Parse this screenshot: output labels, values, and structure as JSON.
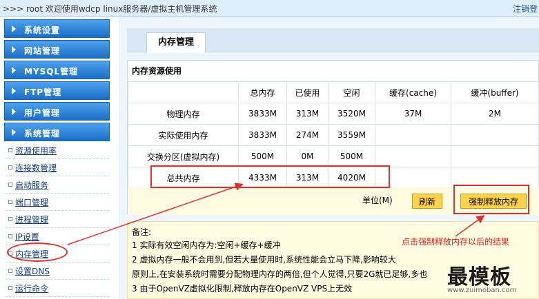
{
  "header": {
    "title": ">>> root 欢迎使用wdcp linux服务器/虚拟主机管理系统",
    "logout": "注销登"
  },
  "sidebar": {
    "menus": [
      {
        "label": "系统设置"
      },
      {
        "label": "网站管理"
      },
      {
        "label": "MYSQL管理"
      },
      {
        "label": "FTP管理"
      },
      {
        "label": "用户管理"
      },
      {
        "label": "系统管理"
      }
    ],
    "items": [
      {
        "label": "资源使用率"
      },
      {
        "label": "连接数管理"
      },
      {
        "label": "启动服务"
      },
      {
        "label": "端口管理"
      },
      {
        "label": "进程管理"
      },
      {
        "label": "IP设置"
      },
      {
        "label": "内存管理"
      },
      {
        "label": "设置DNS"
      },
      {
        "label": "运行命令"
      }
    ]
  },
  "main": {
    "tab": "内存管理",
    "panel_title": "内存资源使用",
    "table": {
      "headers": [
        "",
        "总内存",
        "已使用",
        "空闲",
        "缓存(cache)",
        "缓冲(buffer)"
      ],
      "rows": [
        [
          "物理内存",
          "3833M",
          "313M",
          "3520M",
          "37M",
          "2M"
        ],
        [
          "实际使用内存",
          "3833M",
          "274M",
          "3559M",
          "",
          ""
        ],
        [
          "交换分区(虚拟内存)",
          "500M",
          "0M",
          "500M",
          "",
          ""
        ],
        [
          "总共内存",
          "4333M",
          "313M",
          "4020M",
          "",
          ""
        ]
      ]
    },
    "unit_label": "单位(M)",
    "refresh_label": "刷新",
    "release_label": "强制释放内存",
    "notes": {
      "title": "备注:",
      "lines": [
        "1 实际有效空闲内存为:空闲+缓存+缓冲",
        "2 虚拟内存一般不会用到,但若大量使用时,系统性能会立马下降,影响较大",
        "原则上,在安装系统时需要分配物理内存的两倍,但个人觉得,只要2G就已足够,多也",
        "3 由于OpenVZ虚拟化限制,释放内存在OpenVZ VPS上无效"
      ]
    },
    "annotation": "点击强制释放内存以后的结果"
  },
  "watermark": {
    "text": "最模板",
    "url": "www.zuimoban.com"
  },
  "colors": {
    "menu": "#1a6ec8",
    "accent_red": "#e0302e",
    "button": "#ffd24a"
  }
}
